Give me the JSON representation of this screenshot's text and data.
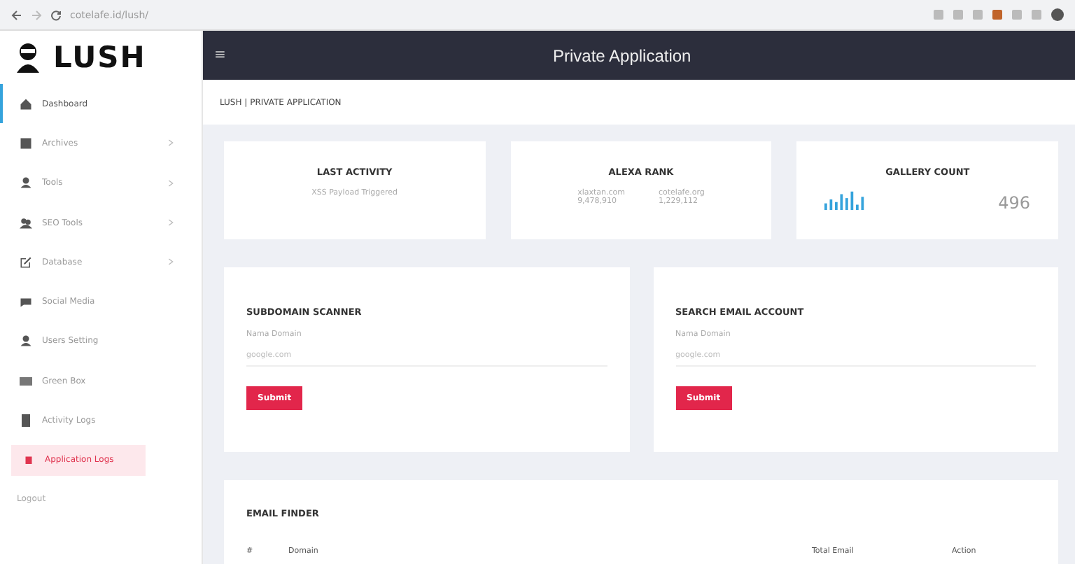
{
  "browser": {
    "url": "cotelafe.id/lush/"
  },
  "brand": {
    "name": "LUSH"
  },
  "topbar": {
    "menu_icon": "≡",
    "title": "Private Application"
  },
  "breadcrumb": "LUSH | PRIVATE APPLICATION",
  "sidebar": {
    "items": [
      {
        "label": "Dashboard",
        "selected": true,
        "expandable": false,
        "kind": "item"
      },
      {
        "label": "Archives",
        "selected": false,
        "expandable": true,
        "kind": "item"
      },
      {
        "label": "Tools",
        "selected": false,
        "expandable": true,
        "kind": "item"
      },
      {
        "label": "SEO Tools",
        "selected": false,
        "expandable": true,
        "kind": "item"
      },
      {
        "label": "Database",
        "selected": false,
        "expandable": true,
        "kind": "item"
      },
      {
        "label": "Social Media",
        "selected": false,
        "expandable": false,
        "kind": "item"
      },
      {
        "label": "Users Setting",
        "selected": false,
        "expandable": false,
        "kind": "item"
      },
      {
        "label": "Green Box",
        "selected": false,
        "expandable": false,
        "kind": "item"
      },
      {
        "label": "Activity Logs",
        "selected": false,
        "expandable": false,
        "kind": "item"
      },
      {
        "label": "Application Logs",
        "selected": false,
        "expandable": false,
        "kind": "alert"
      },
      {
        "label": "Logout",
        "selected": false,
        "expandable": false,
        "kind": "plain"
      }
    ]
  },
  "stats": [
    {
      "kind": "text",
      "title": "LAST ACTIVITY",
      "text": "XSS Payload Triggered"
    },
    {
      "kind": "pair",
      "title": "ALEXA RANK",
      "pairs": [
        {
          "site": "xlaxtan.com",
          "rank": "9,478,910"
        },
        {
          "site": "cotelafe.org",
          "rank": "1,229,112"
        }
      ]
    },
    {
      "kind": "count",
      "title": "GALLERY COUNT",
      "value": "496"
    }
  ],
  "forms": [
    {
      "title": "SUBDOMAIN SCANNER",
      "label": "Nama Domain",
      "placeholder": "google.com",
      "button": "Submit"
    },
    {
      "title": "SEARCH EMAIL ACCOUNT",
      "label": "Nama Domain",
      "placeholder": "google.com",
      "button": "Submit"
    }
  ],
  "email_finder": {
    "title": "EMAIL FINDER",
    "columns": [
      "#",
      "Domain",
      "Total Email",
      "Action"
    ]
  }
}
